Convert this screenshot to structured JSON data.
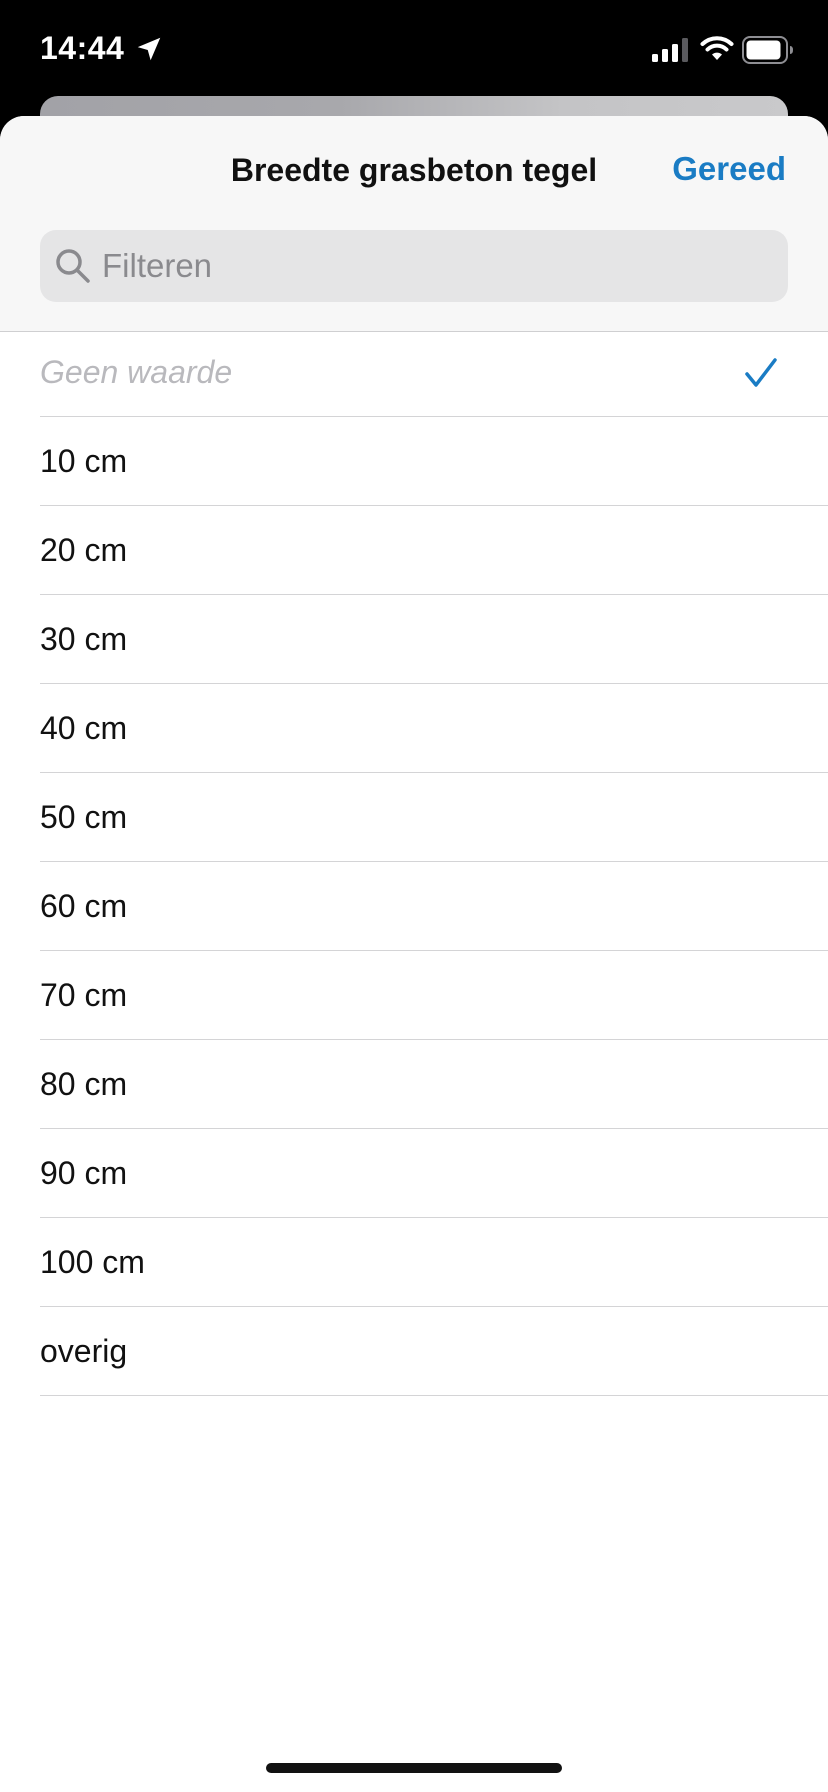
{
  "status_bar": {
    "time": "14:44",
    "icons": [
      "location-arrow-icon",
      "cellular-signal-icon",
      "wifi-icon",
      "battery-icon"
    ]
  },
  "sheet": {
    "title": "Breedte grasbeton tegel",
    "done_label": "Gereed",
    "search": {
      "placeholder": "Filteren",
      "value": ""
    }
  },
  "options": {
    "none_label": "Geen waarde",
    "none_selected": true,
    "items": [
      "10 cm",
      "20 cm",
      "30 cm",
      "40 cm",
      "50 cm",
      "60 cm",
      "70 cm",
      "80 cm",
      "90 cm",
      "100 cm",
      "overig"
    ]
  },
  "colors": {
    "accent": "#1a7cc4",
    "placeholder_text": "#b9b9bd",
    "header_bg": "#f7f7f7",
    "search_bg": "#e5e5e6"
  }
}
